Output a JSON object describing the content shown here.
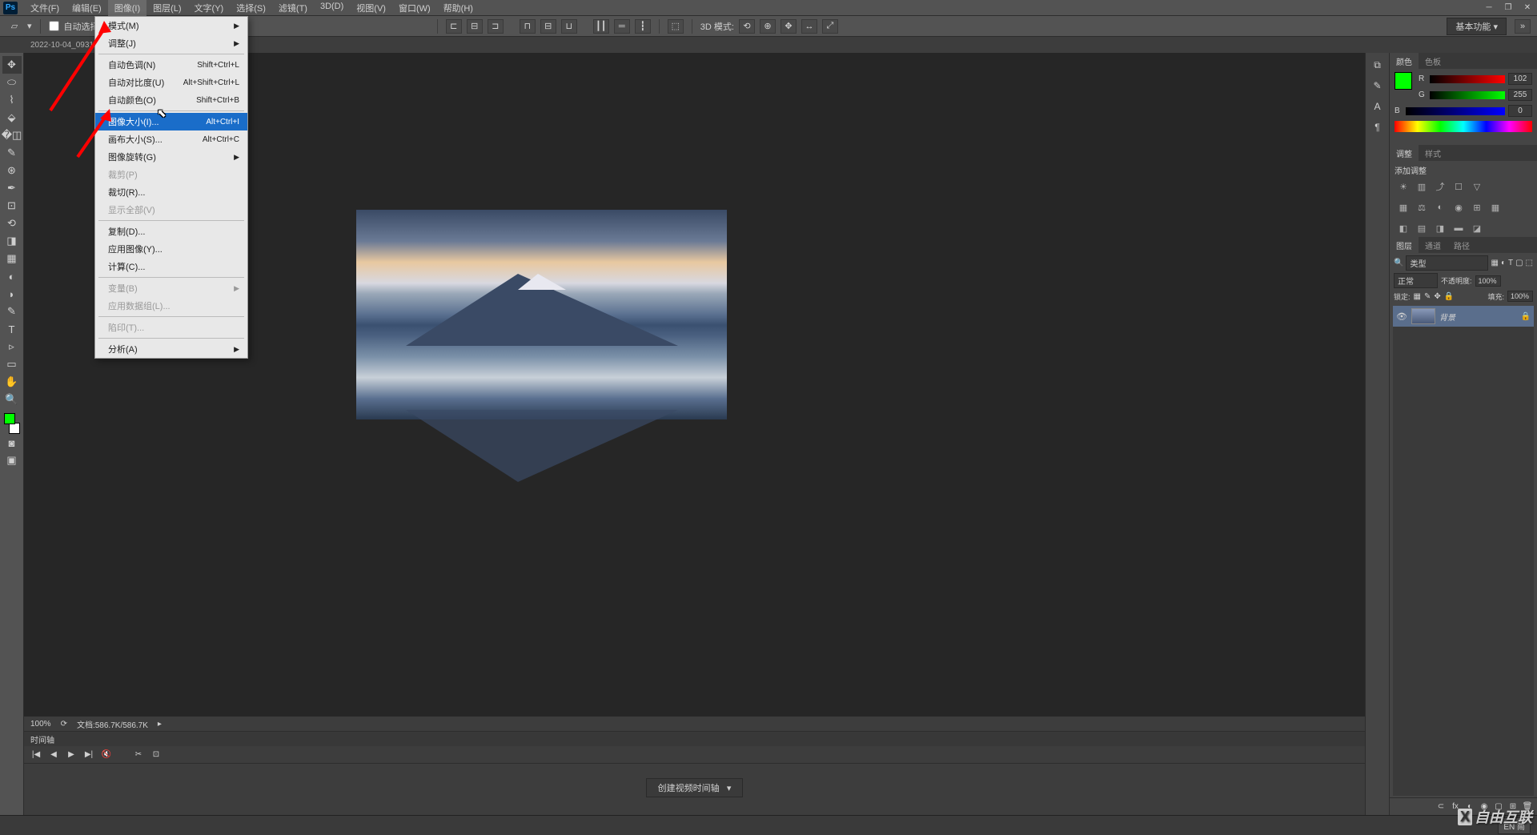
{
  "app": {
    "logo": "Ps"
  },
  "menubar": {
    "items": [
      "文件(F)",
      "编辑(E)",
      "图像(I)",
      "图层(L)",
      "文字(Y)",
      "选择(S)",
      "滤镜(T)",
      "3D(D)",
      "视图(V)",
      "窗口(W)",
      "帮助(H)"
    ],
    "active_index": 2
  },
  "window_controls": {
    "min": "─",
    "max": "❐",
    "close": "✕"
  },
  "options_bar": {
    "auto_select": "自动选择",
    "mode_3d": "3D 模式:",
    "workspace": "基本功能"
  },
  "document_tab": "2022-10-04_0931...",
  "dropdown": {
    "items": [
      {
        "label": "模式(M)",
        "shortcut": "",
        "has_submenu": true,
        "disabled": false,
        "highlighted": false
      },
      {
        "label": "调整(J)",
        "shortcut": "",
        "has_submenu": true,
        "disabled": false,
        "highlighted": false
      },
      {
        "sep": true
      },
      {
        "label": "自动色调(N)",
        "shortcut": "Shift+Ctrl+L",
        "has_submenu": false,
        "disabled": false,
        "highlighted": false
      },
      {
        "label": "自动对比度(U)",
        "shortcut": "Alt+Shift+Ctrl+L",
        "has_submenu": false,
        "disabled": false,
        "highlighted": false
      },
      {
        "label": "自动颜色(O)",
        "shortcut": "Shift+Ctrl+B",
        "has_submenu": false,
        "disabled": false,
        "highlighted": false
      },
      {
        "sep": true
      },
      {
        "label": "图像大小(I)...",
        "shortcut": "Alt+Ctrl+I",
        "has_submenu": false,
        "disabled": false,
        "highlighted": true
      },
      {
        "label": "画布大小(S)...",
        "shortcut": "Alt+Ctrl+C",
        "has_submenu": false,
        "disabled": false,
        "highlighted": false
      },
      {
        "label": "图像旋转(G)",
        "shortcut": "",
        "has_submenu": true,
        "disabled": false,
        "highlighted": false
      },
      {
        "label": "裁剪(P)",
        "shortcut": "",
        "has_submenu": false,
        "disabled": true,
        "highlighted": false
      },
      {
        "label": "裁切(R)...",
        "shortcut": "",
        "has_submenu": false,
        "disabled": false,
        "highlighted": false
      },
      {
        "label": "显示全部(V)",
        "shortcut": "",
        "has_submenu": false,
        "disabled": true,
        "highlighted": false
      },
      {
        "sep": true
      },
      {
        "label": "复制(D)...",
        "shortcut": "",
        "has_submenu": false,
        "disabled": false,
        "highlighted": false
      },
      {
        "label": "应用图像(Y)...",
        "shortcut": "",
        "has_submenu": false,
        "disabled": false,
        "highlighted": false
      },
      {
        "label": "计算(C)...",
        "shortcut": "",
        "has_submenu": false,
        "disabled": false,
        "highlighted": false
      },
      {
        "sep": true
      },
      {
        "label": "变量(B)",
        "shortcut": "",
        "has_submenu": true,
        "disabled": true,
        "highlighted": false
      },
      {
        "label": "应用数据组(L)...",
        "shortcut": "",
        "has_submenu": false,
        "disabled": true,
        "highlighted": false
      },
      {
        "sep": true
      },
      {
        "label": "陷印(T)...",
        "shortcut": "",
        "has_submenu": false,
        "disabled": true,
        "highlighted": false
      },
      {
        "sep": true
      },
      {
        "label": "分析(A)",
        "shortcut": "",
        "has_submenu": true,
        "disabled": false,
        "highlighted": false
      }
    ]
  },
  "color_panel": {
    "tabs": [
      "颜色",
      "色板"
    ],
    "r": {
      "label": "R",
      "value": "102"
    },
    "g": {
      "label": "G",
      "value": "255"
    },
    "b": {
      "label": "B",
      "value": "0"
    }
  },
  "adjustments_panel": {
    "tabs": [
      "调整",
      "样式"
    ],
    "title": "添加调整"
  },
  "layers_panel": {
    "tabs": [
      "图层",
      "通道",
      "路径"
    ],
    "filter_label": "类型",
    "blend_mode": "正常",
    "opacity_label": "不透明度:",
    "opacity_value": "100%",
    "lock_label": "锁定:",
    "fill_label": "填充:",
    "fill_value": "100%",
    "layer": {
      "name": "背景"
    }
  },
  "status": {
    "zoom": "100%",
    "doc_info": "文档:586.7K/586.7K"
  },
  "timeline": {
    "title": "时间轴",
    "create_button": "创建视频时间轴"
  },
  "taskbar": {
    "ime": "EN 简"
  },
  "watermark": "自由互联"
}
